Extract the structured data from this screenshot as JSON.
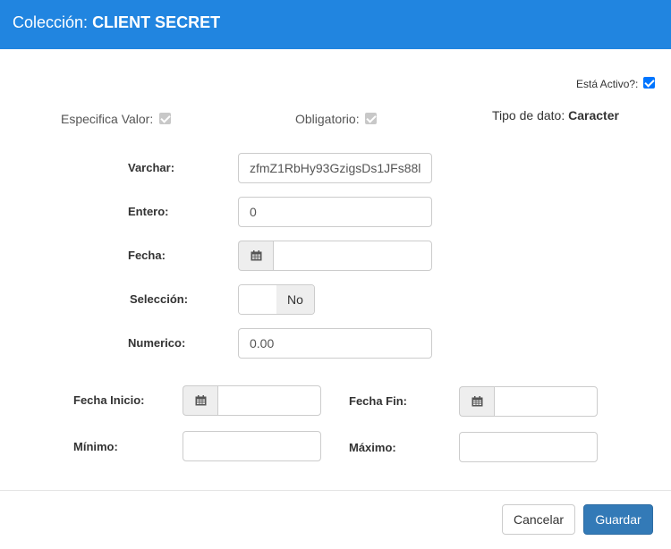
{
  "header": {
    "title_prefix": "Colección:",
    "title_value": "CLIENT SECRET"
  },
  "flags": {
    "active_label": "Está Activo?:",
    "active_checked": true,
    "specific_value_label": "Especifica Valor:",
    "specific_value_checked": true,
    "required_label": "Obligatorio:",
    "required_checked": true
  },
  "data_type": {
    "label": "Tipo de dato:",
    "value": "Caracter"
  },
  "fields": {
    "varchar": {
      "label": "Varchar:",
      "value": "zfmZ1RbHy93GzigsDs1JFs88l"
    },
    "entero": {
      "label": "Entero:",
      "value": "0"
    },
    "fecha": {
      "label": "Fecha:",
      "value": ""
    },
    "seleccion": {
      "label": "Selección:",
      "state": "No"
    },
    "numerico": {
      "label": "Numerico:",
      "value": "0.00"
    }
  },
  "range": {
    "fecha_inicio_label": "Fecha Inicio:",
    "fecha_fin_label": "Fecha Fin:",
    "minimo_label": "Mínimo:",
    "maximo_label": "Máximo:"
  },
  "footer": {
    "cancel_label": "Cancelar",
    "save_label": "Guardar"
  },
  "icons": {
    "calendar": "calendar-icon",
    "checkbox": "check-icon"
  },
  "colors": {
    "header_bg": "#2185e0",
    "primary_button": "#337ab7",
    "checkbox_active": "#0075ff"
  }
}
